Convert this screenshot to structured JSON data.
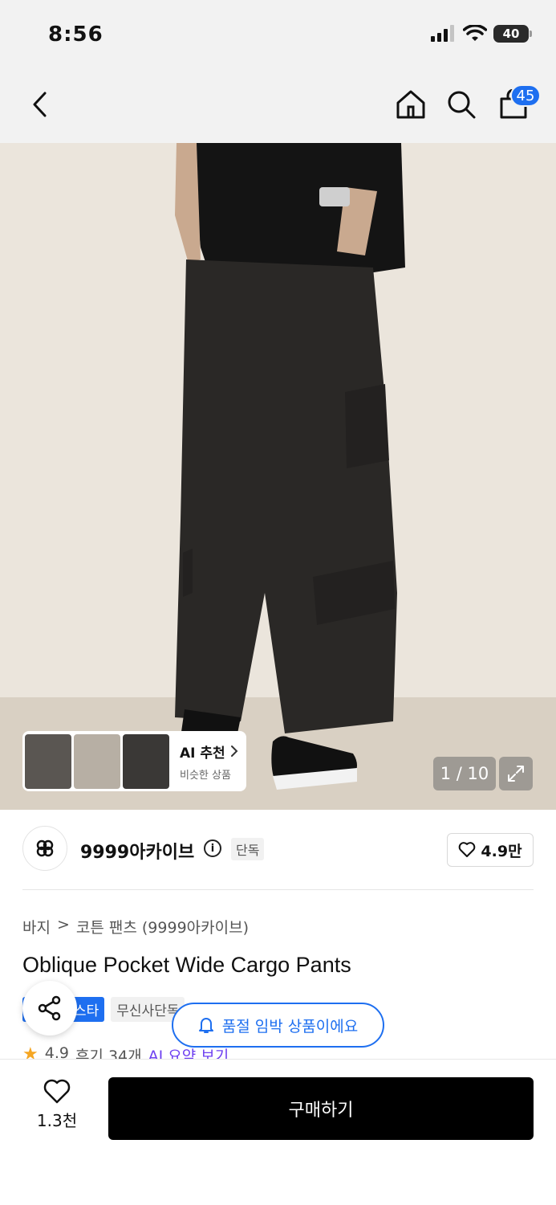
{
  "status_bar": {
    "time": "8:56",
    "battery": "40"
  },
  "nav": {
    "cart_count": "45"
  },
  "gallery": {
    "ai_title": "AI 추천",
    "ai_subtitle": "비슷한 상품",
    "page_counter": "1 / 10"
  },
  "brand": {
    "name": "9999아카이브",
    "exclusive_tag": "단독",
    "likes": "4.9만"
  },
  "product": {
    "breadcrumb": [
      "바지",
      "코튼 팬츠 (9999아카이브)"
    ],
    "title": "Oblique Pocket Wide Cargo Pants",
    "tags": [
      "스타",
      "무신사단독"
    ],
    "soldout_notice": "품절 임박 상품이에요",
    "rating": "4.9",
    "reviews": "후기 34개",
    "ai_summary": "AI 요약 보기"
  },
  "bottom": {
    "wishlist_count": "1.3천",
    "buy_label": "구매하기"
  },
  "colors": {
    "accent": "#1e6ff0",
    "buy_button": "#000000"
  }
}
